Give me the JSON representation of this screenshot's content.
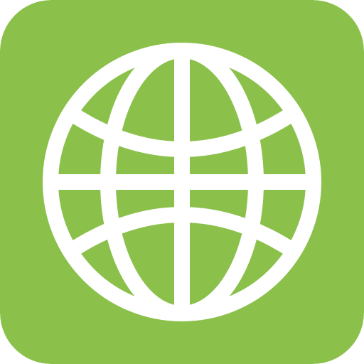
{
  "icon": {
    "name": "globe-icon",
    "background_color": "#8BC14B",
    "glyph_color": "#FFFFFF"
  }
}
